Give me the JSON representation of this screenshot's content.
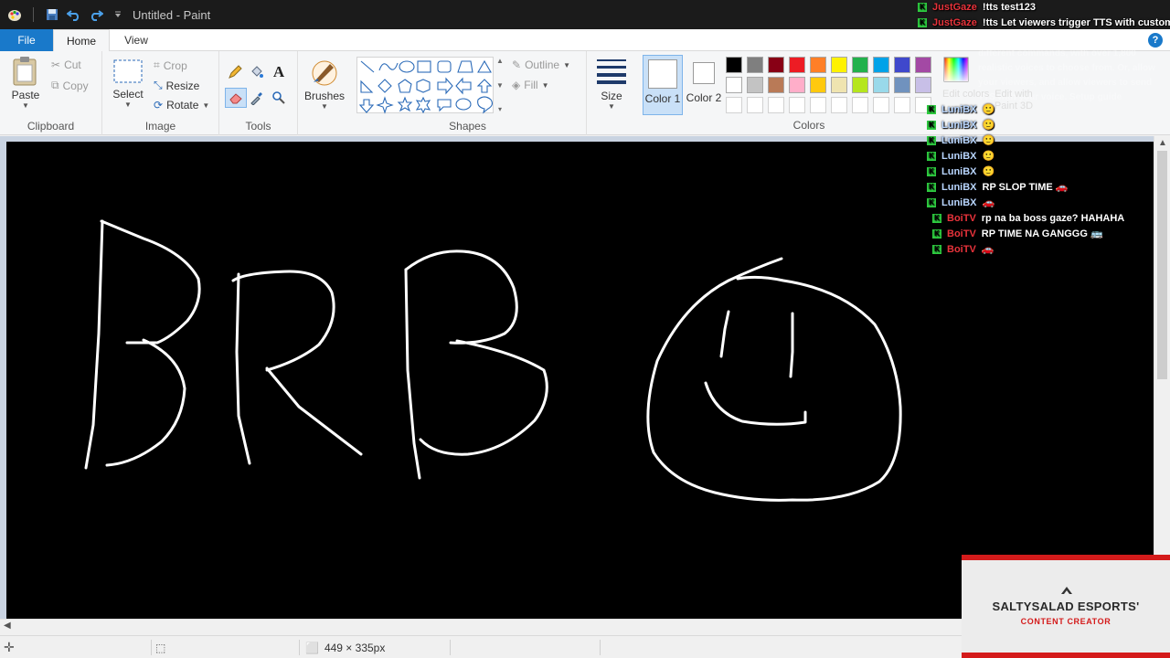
{
  "window": {
    "title": "Untitled - Paint"
  },
  "tabs": [
    {
      "label": "File"
    },
    {
      "label": "Home"
    },
    {
      "label": "View"
    }
  ],
  "ribbon": {
    "clipboard": {
      "group": "Clipboard",
      "paste": "Paste",
      "cut": "Cut",
      "copy": "Copy"
    },
    "image": {
      "group": "Image",
      "select": "Select",
      "crop": "Crop",
      "resize": "Resize",
      "rotate": "Rotate"
    },
    "tools": {
      "group": "Tools"
    },
    "brushes": {
      "label": "Brushes"
    },
    "shapes": {
      "group": "Shapes",
      "outline": "Outline",
      "fill": "Fill"
    },
    "size": {
      "label": "Size"
    },
    "colors": {
      "group": "Colors",
      "color1": "Color 1",
      "color2": "Color 2",
      "edit_colors": "Edit colors",
      "edit_paint3d": "Edit with Paint 3D",
      "color1_value": "#ffffff",
      "color2_value": "#ffffff",
      "palette_row1": [
        "#000000",
        "#7f7f7f",
        "#880015",
        "#ed1c24",
        "#ff7f27",
        "#fff200",
        "#22b14c",
        "#00a2e8",
        "#3f48cc",
        "#a349a4"
      ],
      "palette_row2": [
        "#ffffff",
        "#c3c3c3",
        "#b97a57",
        "#ffaec9",
        "#ffc90e",
        "#efe4b0",
        "#b5e61d",
        "#99d9ea",
        "#7092be",
        "#c8bfe7"
      ]
    }
  },
  "statusbar": {
    "canvas_size": "449 × 335px"
  },
  "chat": {
    "messages": [
      {
        "user": "JustGaze",
        "user_color": "#e8333b",
        "text": "!tts test123"
      },
      {
        "user": "JustGaze",
        "user_color": "#e8333b",
        "text": "!tts Let viewers trigger TTS with custom"
      },
      {
        "user": "LuniBX",
        "user_color": "#b9d6ff",
        "text": "🙂"
      },
      {
        "user": "LuniBX",
        "user_color": "#b9d6ff",
        "text": "🙂"
      },
      {
        "user": "LuniBX",
        "user_color": "#b9d6ff",
        "text": "🙂"
      },
      {
        "user": "LuniBX",
        "user_color": "#b9d6ff",
        "text": "🙂"
      },
      {
        "user": "LuniBX",
        "user_color": "#b9d6ff",
        "text": "🙂"
      },
      {
        "user": "LuniBX",
        "user_color": "#b9d6ff",
        "text": "RP SLOP TIME 🚗"
      },
      {
        "user": "LuniBX",
        "user_color": "#b9d6ff",
        "text": "🚗"
      },
      {
        "user": "BoiTV",
        "user_color": "#e8333b",
        "text": "rp na ba boss gaze? HAHAHA"
      },
      {
        "user": "BoiTV",
        "user_color": "#e8333b",
        "text": "RP TIME NA GANGGG 🚌"
      },
      {
        "user": "BoiTV",
        "user_color": "#e8333b",
        "text": "🚗"
      }
    ],
    "faint_text": "commands. Assign different voices to different commands, with over 1,800 realistic voices to choose from. Or, allow your viewers, and allow viewers to send TTS with your voice. Setup guide"
  },
  "brand": {
    "name": "SALTYSALAD ESPORTS'",
    "role": "CONTENT CREATOR"
  }
}
